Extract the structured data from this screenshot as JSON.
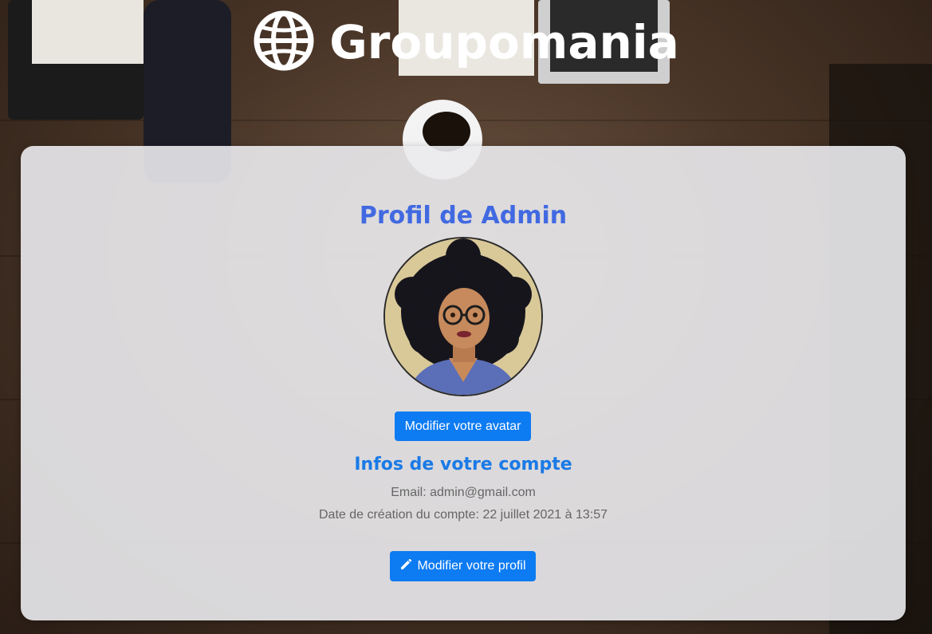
{
  "header": {
    "logo_text": "Groupomania",
    "logo_icon": "globe-icon"
  },
  "profile": {
    "title": "Profil de Admin",
    "avatar_alt": "Avatar de Admin",
    "modify_avatar_label": "Modifier votre avatar"
  },
  "account": {
    "section_title": "Infos de votre compte",
    "email_line": "Email: admin@gmail.com",
    "created_line": "Date de création du compte: 22 juillet 2021 à 13:57",
    "modify_profile_label": "Modifier votre profil",
    "modify_profile_icon": "pencil-icon"
  },
  "colors": {
    "title_blue": "#4169e1",
    "section_blue": "#1a7ae6",
    "button_blue": "#0d7bf2"
  }
}
